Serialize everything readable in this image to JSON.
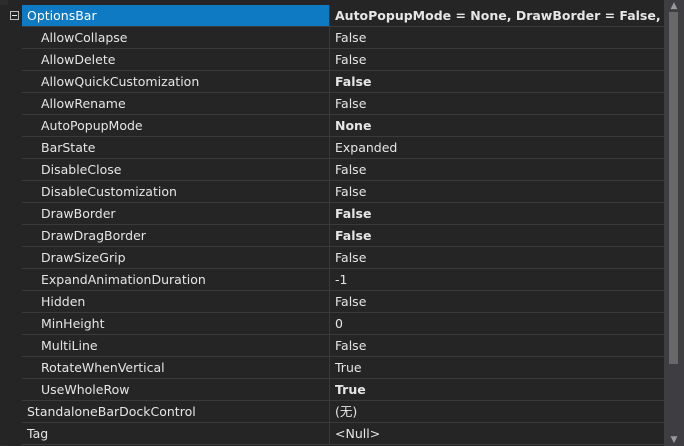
{
  "properties": {
    "options_bar": {
      "name": "OptionsBar",
      "value": "AutoPopupMode = None, DrawBorder = False, A"
    },
    "children": [
      {
        "name": "AllowCollapse",
        "value": "False",
        "bold": false
      },
      {
        "name": "AllowDelete",
        "value": "False",
        "bold": false
      },
      {
        "name": "AllowQuickCustomization",
        "value": "False",
        "bold": true
      },
      {
        "name": "AllowRename",
        "value": "False",
        "bold": false
      },
      {
        "name": "AutoPopupMode",
        "value": "None",
        "bold": true
      },
      {
        "name": "BarState",
        "value": "Expanded",
        "bold": false
      },
      {
        "name": "DisableClose",
        "value": "False",
        "bold": false
      },
      {
        "name": "DisableCustomization",
        "value": "False",
        "bold": false
      },
      {
        "name": "DrawBorder",
        "value": "False",
        "bold": true
      },
      {
        "name": "DrawDragBorder",
        "value": "False",
        "bold": true
      },
      {
        "name": "DrawSizeGrip",
        "value": "False",
        "bold": false
      },
      {
        "name": "ExpandAnimationDuration",
        "value": "-1",
        "bold": false
      },
      {
        "name": "Hidden",
        "value": "False",
        "bold": false
      },
      {
        "name": "MinHeight",
        "value": "0",
        "bold": false
      },
      {
        "name": "MultiLine",
        "value": "False",
        "bold": false
      },
      {
        "name": "RotateWhenVertical",
        "value": "True",
        "bold": false
      },
      {
        "name": "UseWholeRow",
        "value": "True",
        "bold": true
      }
    ],
    "top_level": [
      {
        "name": "StandaloneBarDockControl",
        "value": "(无)"
      },
      {
        "name": "Tag",
        "value": "<Null>"
      }
    ]
  },
  "icons": {
    "expander": "collapse-minus-icon",
    "scroll_up": "scroll-up-arrow-icon",
    "scroll_down": "scroll-down-arrow-icon"
  },
  "colors": {
    "background": "#252526",
    "selection": "#0e7ac4",
    "gridline": "#3a3a3a",
    "text": "#e6e6e6",
    "scrollbar_track": "#3e3e42",
    "scrollbar_thumb": "#686868"
  }
}
